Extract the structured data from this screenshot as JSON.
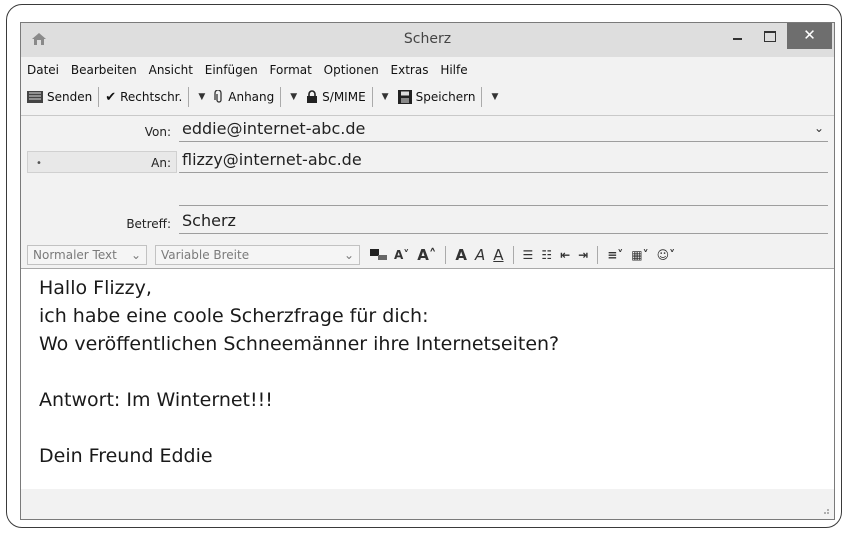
{
  "window": {
    "title": "Scherz",
    "close_label": "✕"
  },
  "menu": [
    "Datei",
    "Bearbeiten",
    "Ansicht",
    "Einfügen",
    "Format",
    "Optionen",
    "Extras",
    "Hilfe"
  ],
  "toolbar": {
    "send": "Senden",
    "spell": "Rechtschr.",
    "attach": "Anhang",
    "smime": "S/MIME",
    "save": "Speichern"
  },
  "header": {
    "from_label": "Von:",
    "from_value": "eddie@internet-abc.de",
    "to_label": "An:",
    "to_value": "flizzy@internet-abc.de",
    "subject_label": "Betreff:",
    "subject_value": "Scherz"
  },
  "format": {
    "paragraph_style": "Normaler Text",
    "font": "Variable Breite"
  },
  "body": {
    "line1": "Hallo Flizzy,",
    "line2": "ich habe eine coole Scherzfrage für dich:",
    "line3": "Wo veröffentlichen Schneemänner ihre Internetseiten?",
    "line4": "Antwort: Im Winternet!!!",
    "line5": "Dein Freund Eddie"
  },
  "icons": [
    "app-icon",
    "send-icon",
    "checkmark-icon",
    "paperclip-icon",
    "lock-icon",
    "floppy-icon",
    "chevron-down-icon",
    "text-color-icon",
    "smaller-font-icon",
    "larger-font-icon",
    "bold-icon",
    "italic-icon",
    "underline-icon",
    "bullet-list-icon",
    "numbered-list-icon",
    "outdent-icon",
    "indent-icon",
    "align-icon",
    "insert-icon",
    "smiley-icon"
  ]
}
